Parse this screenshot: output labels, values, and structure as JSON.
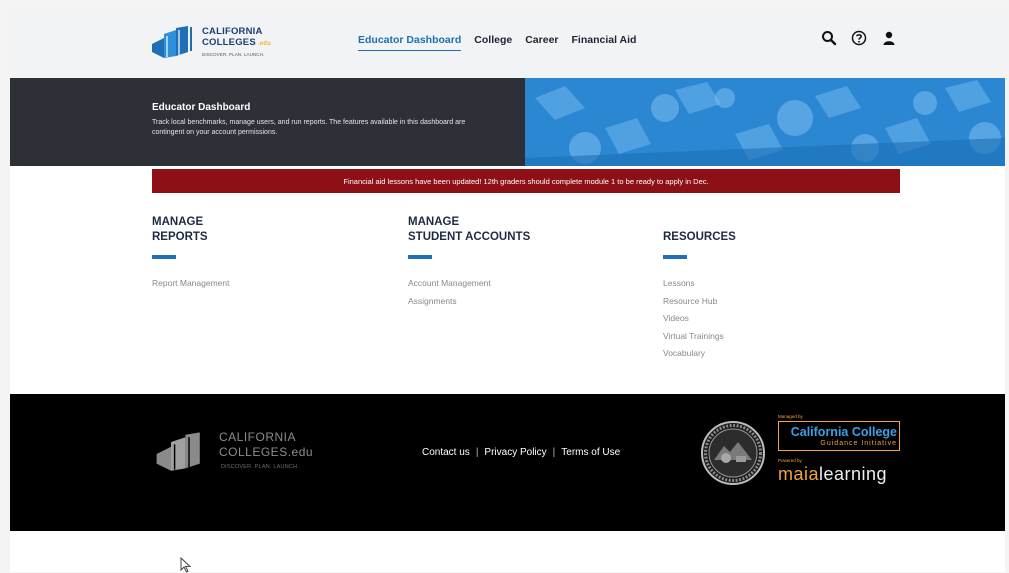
{
  "header": {
    "logo": {
      "line1": "CALIFORNIA",
      "line2": "COLLEGES",
      "edu": ".edu",
      "tagline": "DISCOVER. PLAN. LAUNCH."
    },
    "nav": [
      {
        "label": "Educator Dashboard",
        "active": true
      },
      {
        "label": "College"
      },
      {
        "label": "Career"
      },
      {
        "label": "Financial Aid"
      }
    ],
    "icons": [
      "search-icon",
      "help-icon",
      "user-icon"
    ]
  },
  "hero": {
    "title": "Educator Dashboard",
    "description": "Track local benchmarks, manage users, and run reports. The features available in this dashboard are contingent on your account permissions."
  },
  "banner": {
    "text": "Financial aid lessons have been updated! 12th graders should complete module 1 to be ready to apply in Dec."
  },
  "columns": [
    {
      "heading_line1": "MANAGE",
      "heading_line2": "REPORTS",
      "links": [
        "Report Management"
      ]
    },
    {
      "heading_line1": "MANAGE",
      "heading_line2": "STUDENT ACCOUNTS",
      "links": [
        "Account Management",
        "Assignments"
      ]
    },
    {
      "heading_line1": "",
      "heading_line2": "RESOURCES",
      "links": [
        "Lessons",
        "Resource Hub",
        "Videos",
        "Virtual Trainings",
        "Vocabulary"
      ]
    }
  ],
  "footer": {
    "logo": {
      "line1": "CALIFORNIA",
      "line2": "COLLEGES.edu",
      "tagline": "DISCOVER. PLAN. LAUNCH."
    },
    "links": [
      "Contact us",
      "Privacy Policy",
      "Terms of Use"
    ],
    "managed_by": "Managed by",
    "ccgi_name": "California College",
    "ccgi_sub": "Guidance Initiative",
    "powered_by": "Powered by",
    "maia_1": "maia",
    "maia_2": "learning"
  },
  "colors": {
    "accent": "#1e6fb5",
    "banner": "#8d1016",
    "hero_dark": "#2d3036",
    "hero_blue": "#2b87d2",
    "footer": "#000000",
    "gold": "#f2a53c"
  }
}
